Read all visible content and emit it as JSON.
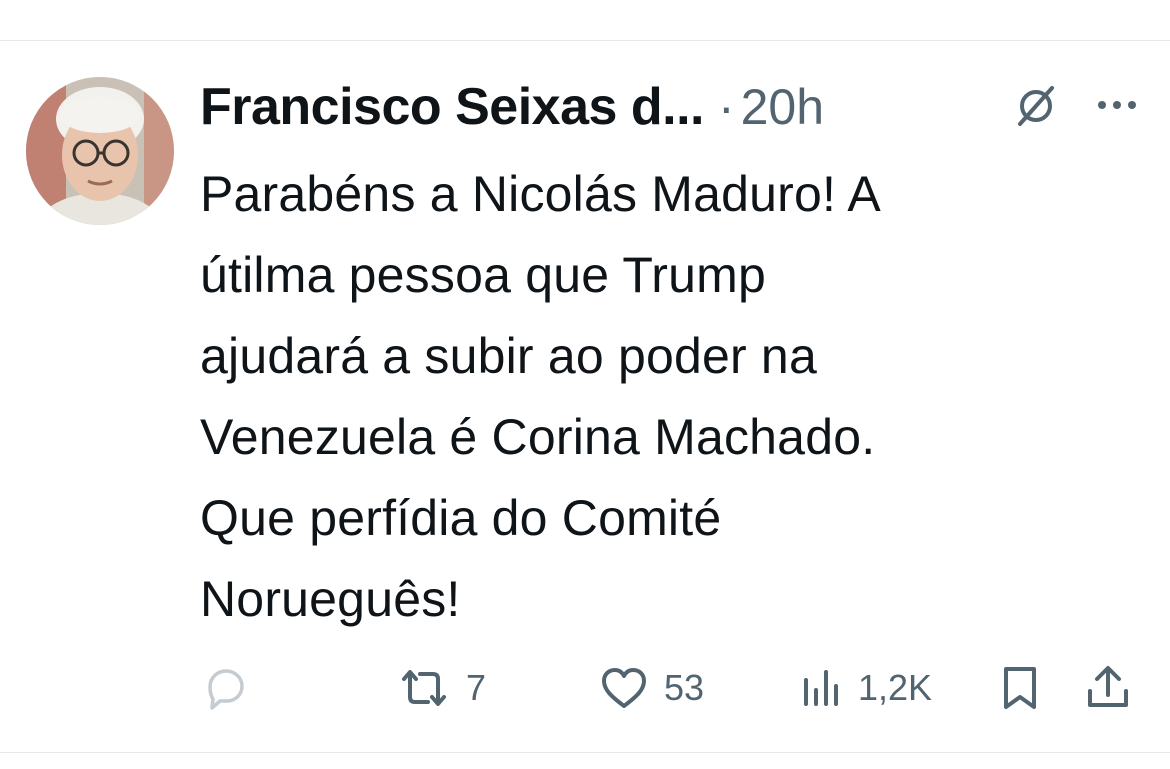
{
  "tweet": {
    "author_name": "Francisco Seixas d...",
    "separator": "·",
    "time": "20h",
    "text": "Parabéns a Nicolás Maduro! A\nútilma pessoa que Trump\najudará a subir ao poder na\nVenezuela é Corina Machado.\nQue perfídia do Comité\nNorueguês!"
  },
  "icons": {
    "grok": "grok-icon",
    "more": "more-icon",
    "reply": "reply-icon",
    "retweet": "retweet-icon",
    "like": "heart-icon",
    "views": "views-icon",
    "bookmark": "bookmark-icon",
    "share": "share-icon"
  },
  "actions": {
    "retweets": "7",
    "likes": "53",
    "views": "1,2K"
  },
  "colors": {
    "text": "#0f1419",
    "secondary": "#536471",
    "divider": "#e6e9ec"
  }
}
